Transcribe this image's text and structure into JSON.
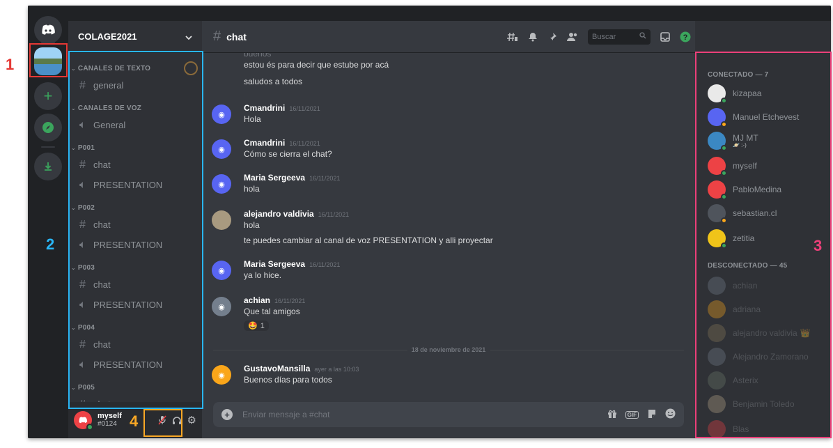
{
  "server": {
    "name": "COLAGE2021",
    "chevron": "chevron-down-icon"
  },
  "sidebar": {
    "categories": [
      {
        "label": "CANALES DE TEXTO",
        "channels": [
          {
            "type": "text",
            "label": "general"
          }
        ]
      },
      {
        "label": "CANALES DE VOZ",
        "channels": [
          {
            "type": "voice",
            "label": "General"
          }
        ]
      },
      {
        "label": "P001",
        "channels": [
          {
            "type": "text",
            "label": "chat"
          },
          {
            "type": "voice",
            "label": "PRESENTATION"
          }
        ]
      },
      {
        "label": "P002",
        "channels": [
          {
            "type": "text",
            "label": "chat"
          },
          {
            "type": "voice",
            "label": "PRESENTATION"
          }
        ]
      },
      {
        "label": "P003",
        "channels": [
          {
            "type": "text",
            "label": "chat"
          },
          {
            "type": "voice",
            "label": "PRESENTATION"
          }
        ]
      },
      {
        "label": "P004",
        "channels": [
          {
            "type": "text",
            "label": "chat"
          },
          {
            "type": "voice",
            "label": "PRESENTATION"
          }
        ]
      },
      {
        "label": "P005",
        "channels": [
          {
            "type": "text",
            "label": "chat"
          }
        ]
      }
    ]
  },
  "user": {
    "name": "myself",
    "tag": "#0124"
  },
  "chat": {
    "channel": "chat",
    "search_placeholder": "Buscar",
    "composer_placeholder": "Enviar mensaje a #chat",
    "partial_top": "buenos",
    "lines": [
      "estou és para decir que estube por acá",
      "saludos a todos"
    ],
    "messages": [
      {
        "author": "Cmandrini",
        "time": "16/11/2021",
        "text": [
          "Hola"
        ]
      },
      {
        "author": "Cmandrini",
        "time": "16/11/2021",
        "text": [
          "Cómo se cierra el chat?"
        ]
      },
      {
        "author": "Maria Sergeeva",
        "time": "16/11/2021",
        "text": [
          "hola"
        ]
      },
      {
        "author": "alejandro valdivia",
        "time": "16/11/2021",
        "text": [
          "hola",
          "te puedes cambiar al canal de voz PRESENTATION y alli proyectar"
        ]
      },
      {
        "author": "Maria Sergeeva",
        "time": "16/11/2021",
        "text": [
          "ya lo hice."
        ]
      },
      {
        "author": "achian",
        "time": "16/11/2021",
        "text": [
          "Que tal amigos"
        ],
        "reaction": {
          "emoji": "🤩",
          "count": "1"
        }
      },
      {
        "author": "GustavoMansilla",
        "time": "ayer a las 10:03",
        "text": [
          "Buenos días para todos"
        ]
      }
    ],
    "date_divider": "18 de noviembre de 2021"
  },
  "members": {
    "online_header": "CONECTADO — 7",
    "offline_header": "DESCONECTADO — 45",
    "online": [
      {
        "name": "kizapaa",
        "color": "#ffffff"
      },
      {
        "name": "Manuel Etchevest",
        "color": "#5865f2"
      },
      {
        "name": "MJ MT",
        "status": "🪐 :-)",
        "color": "#3b88c3"
      },
      {
        "name": "myself",
        "color": "#ed4245"
      },
      {
        "name": "PabloMedina",
        "color": "#ed4245"
      },
      {
        "name": "sebastian.cl",
        "color": "#4f545c"
      },
      {
        "name": "zetitia",
        "color": "#f0c419"
      }
    ],
    "offline": [
      {
        "name": "achian",
        "color": "#747f8d"
      },
      {
        "name": "adriana",
        "color": "#faa61a"
      },
      {
        "name": "alejandro valdivia",
        "badge": "👑",
        "color": "#8a7a5a"
      },
      {
        "name": "Alejandro Zamorano",
        "color": "#747f8d"
      },
      {
        "name": "Asterix",
        "color": "#6b7a6b"
      },
      {
        "name": "Benjamin Toledo",
        "color": "#b9a68a"
      },
      {
        "name": "Blas",
        "color": "#ed4245"
      }
    ]
  },
  "annotations": [
    "1",
    "2",
    "3",
    "4"
  ],
  "colors": {
    "bg": "#36393f",
    "sidebar": "#2f3136",
    "rail": "#202225",
    "blurple": "#5865f2",
    "annot_red": "#e53935",
    "annot_blue": "#29b6f6",
    "annot_pink": "#ec407a",
    "annot_yellow": "#f9a825"
  }
}
